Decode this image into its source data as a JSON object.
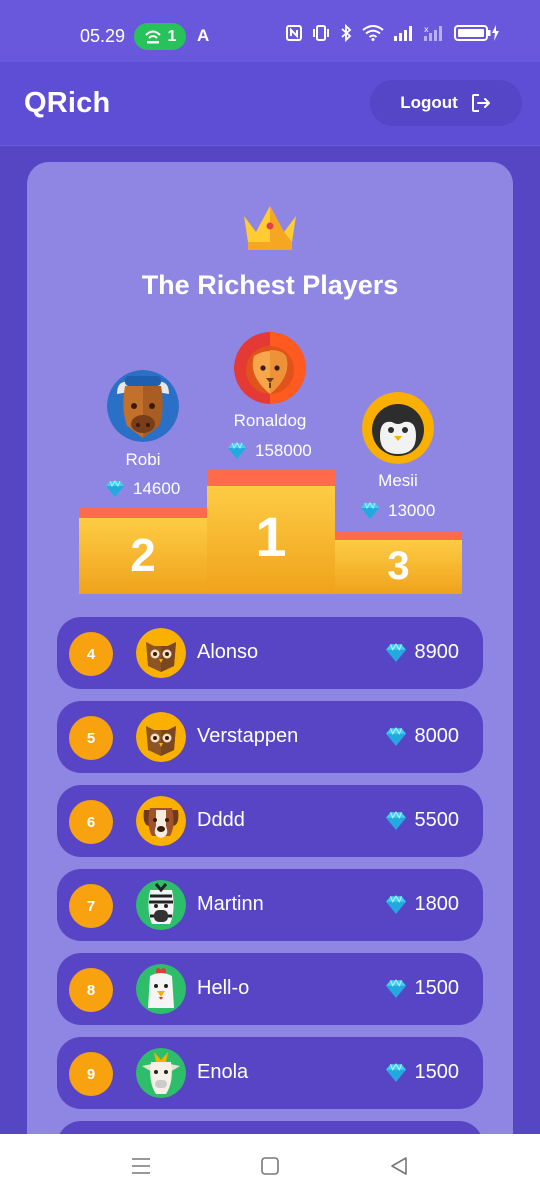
{
  "status_bar": {
    "time": "05.29",
    "hotspot_count": "1",
    "icons": [
      "hotspot-icon",
      "nfc-icon",
      "vibrate-icon",
      "bluetooth-icon",
      "wifi-icon",
      "signal-icon",
      "signal-icon",
      "battery-charging-icon"
    ]
  },
  "app_bar": {
    "title": "QRich",
    "logout_label": "Logout",
    "logout_icon": "logout-icon"
  },
  "leaderboard": {
    "title": "The Richest Players",
    "podium": [
      {
        "place": "2",
        "name": "Robi",
        "score": "14600",
        "avatar": "bison-icon"
      },
      {
        "place": "1",
        "name": "Ronaldog",
        "score": "158000",
        "avatar": "lion-icon"
      },
      {
        "place": "3",
        "name": "Mesii",
        "score": "13000",
        "avatar": "penguin-icon"
      }
    ],
    "rows": [
      {
        "rank": "4",
        "name": "Alonso",
        "score": "8900",
        "avatar": "owl-icon"
      },
      {
        "rank": "5",
        "name": "Verstappen",
        "score": "8000",
        "avatar": "owl-icon"
      },
      {
        "rank": "6",
        "name": "Dddd",
        "score": "5500",
        "avatar": "dog-icon"
      },
      {
        "rank": "7",
        "name": "Martinn",
        "score": "1800",
        "avatar": "zebra-icon"
      },
      {
        "rank": "8",
        "name": "Hell-o",
        "score": "1500",
        "avatar": "chicken-icon"
      },
      {
        "rank": "9",
        "name": "Enola",
        "score": "1500",
        "avatar": "goat-icon"
      }
    ]
  },
  "nav_bar": {
    "icons": [
      "menu-icon",
      "home-icon",
      "back-icon"
    ]
  },
  "colors": {
    "background": "#5646c4",
    "card": "#8f86e3",
    "row": "#5745c6",
    "rank_badge": "#f7a20e",
    "podium_top": "#ff6a4a",
    "gem": "#3fd0f0"
  }
}
